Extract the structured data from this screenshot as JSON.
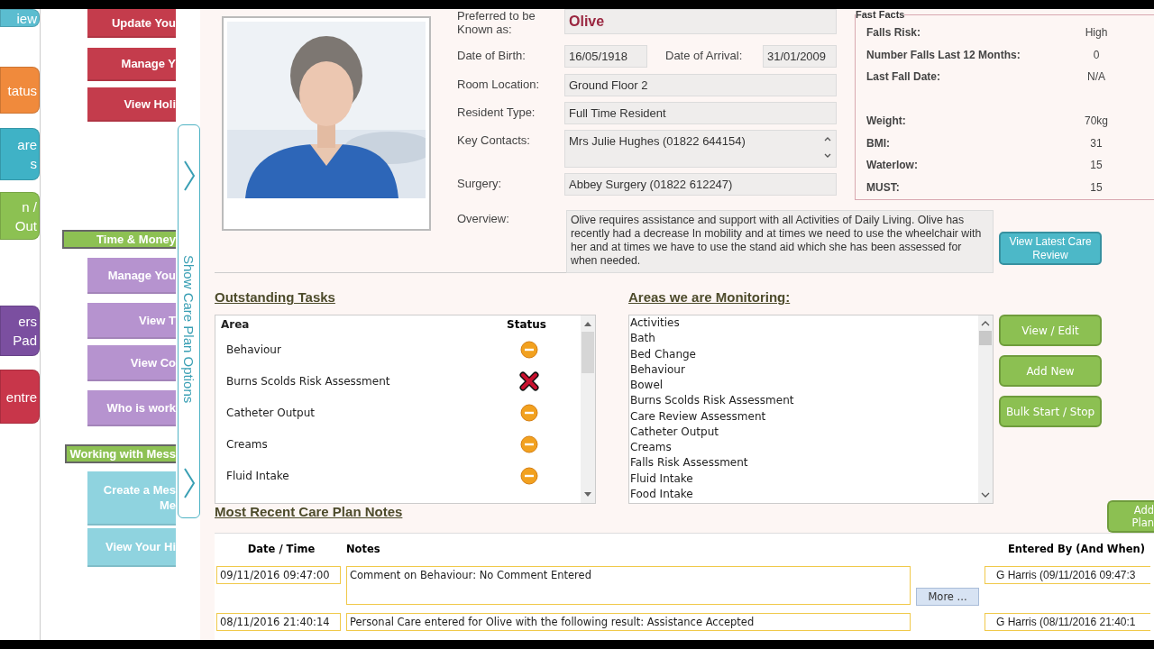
{
  "nav_tiles": [
    {
      "lines": [
        "iew"
      ],
      "color": "#5bbdd0"
    },
    {
      "lines": [
        "tatus"
      ],
      "color": "#f08a3c"
    },
    {
      "lines": [
        "are",
        "s"
      ],
      "color": "#3fb2c6"
    },
    {
      "lines": [
        "n /",
        "Out"
      ],
      "color": "#8cc152"
    },
    {
      "lines": [
        "ers",
        "Pad"
      ],
      "color": "#7b4fa0"
    },
    {
      "lines": [
        "entre"
      ],
      "color": "#c8364a"
    }
  ],
  "submenu": [
    {
      "kind": "button",
      "lines": [
        "Update You"
      ],
      "color": "#c43c4c"
    },
    {
      "kind": "button",
      "lines": [
        "Manage Y"
      ],
      "color": "#c43c4c"
    },
    {
      "kind": "button",
      "lines": [
        "View Holi"
      ],
      "color": "#c43c4c"
    },
    {
      "kind": "header",
      "lines": [
        "Time & Money"
      ]
    },
    {
      "kind": "button",
      "lines": [
        "Manage You"
      ],
      "color": "#b693cf"
    },
    {
      "kind": "button",
      "lines": [
        "View T"
      ],
      "color": "#b693cf"
    },
    {
      "kind": "button",
      "lines": [
        "View Co"
      ],
      "color": "#b693cf"
    },
    {
      "kind": "button",
      "lines": [
        "Who is work"
      ],
      "color": "#b693cf"
    },
    {
      "kind": "header",
      "lines": [
        "Working with Mess"
      ]
    },
    {
      "kind": "button",
      "lines": [
        "Create a Mes",
        "Me"
      ],
      "color": "#8fd3df"
    },
    {
      "kind": "button",
      "lines": [
        "View Your Hi"
      ],
      "color": "#8fd3df"
    }
  ],
  "side_tab": {
    "label": "Show Care Plan Options"
  },
  "profile": {
    "preferred": {
      "label": "Preferred to be Known as:",
      "value": "Olive"
    },
    "dob": {
      "label": "Date of Birth:",
      "value": "16/05/1918"
    },
    "arrival": {
      "label": "Date of Arrival:",
      "value": "31/01/2009"
    },
    "fields": [
      {
        "label": "Room Location:",
        "value": "Ground Floor 2",
        "kind": "text"
      },
      {
        "label": "Resident Type:",
        "value": "Full Time Resident",
        "kind": "text"
      },
      {
        "label": "Key Contacts:",
        "value": "Mrs Julie Hughes (01822 644154)",
        "kind": "list"
      },
      {
        "label": "Surgery:",
        "value": "Abbey Surgery (01822 612247)",
        "kind": "text"
      }
    ],
    "overview": {
      "label": "Overview:",
      "value": "Olive requires assistance and support with all Activities of Daily Living. Olive has recently had a decrease In mobility and at times we need to use the wheelchair with her and at times we have to use the stand aid which she has been assessed for when needed."
    },
    "review_button": "View Latest Care Review"
  },
  "fast_facts": {
    "title": "Fast Facts",
    "groups": [
      [
        {
          "label": "Falls Risk:",
          "value": "High"
        },
        {
          "label": "Number Falls Last 12 Months:",
          "value": "0"
        },
        {
          "label": "Last Fall Date:",
          "value": "N/A"
        }
      ],
      [
        {
          "label": "Weight:",
          "value": "70kg"
        },
        {
          "label": "BMI:",
          "value": "31"
        },
        {
          "label": "Waterlow:",
          "value": "15"
        },
        {
          "label": "MUST:",
          "value": "15"
        }
      ]
    ]
  },
  "outstanding_tasks": {
    "title": "Outstanding Tasks",
    "columns": [
      "Area",
      "Status"
    ],
    "rows": [
      {
        "area": "Behaviour",
        "overdue": false
      },
      {
        "area": "Burns Scolds Risk Assessment",
        "overdue": true
      },
      {
        "area": "Catheter Output",
        "overdue": false
      },
      {
        "area": "Creams",
        "overdue": false
      },
      {
        "area": "Fluid Intake",
        "overdue": false
      }
    ]
  },
  "monitoring": {
    "title": "Areas we are Monitoring:",
    "items": [
      "Activities",
      "Bath",
      "Bed Change",
      "Behaviour",
      "Bowel",
      "Burns Scolds Risk Assessment",
      "Care Review Assessment",
      "Catheter Output",
      "Creams",
      "Falls Risk Assessment",
      "Fluid Intake",
      "Food Intake"
    ],
    "buttons": [
      "View / Edit",
      "Add New",
      "Bulk Start / Stop"
    ]
  },
  "notes": {
    "title": "Most Recent Care Plan Notes",
    "add_button": [
      "Add",
      "Plan"
    ],
    "columns": [
      "Date / Time",
      "Notes",
      "Entered By (And When)"
    ],
    "rows": [
      {
        "date": "09/11/2016 09:47:00",
        "note": "Comment on Behaviour: No Comment Entered",
        "more": "More ...",
        "entered_by": "G Harris (09/11/2016 09:47:3"
      },
      {
        "date": "08/11/2016 21:40:14",
        "note": "Personal Care entered for Olive with the following result: Assistance Accepted",
        "entered_by": "G Harris (08/11/2016 21:40:1"
      }
    ]
  }
}
